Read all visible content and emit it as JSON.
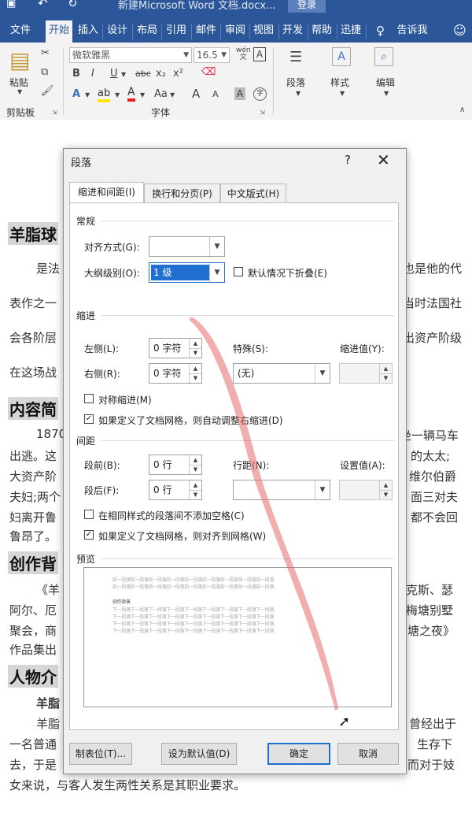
{
  "titlebar": {
    "quick_icons": [
      "save-icon",
      "undo-icon",
      "redo-icon"
    ],
    "doc_title": "新建Microsoft Word 文档.docx...",
    "login_label": "登录"
  },
  "ribbon_tabs": [
    "文件",
    "开始",
    "插入",
    "设计",
    "布局",
    "引用",
    "邮件",
    "审阅",
    "视图",
    "开发",
    "帮助",
    "迅捷",
    "告诉我"
  ],
  "ribbon": {
    "clipboard": {
      "paste_label": "粘贴",
      "group_label": "剪贴板"
    },
    "font": {
      "font_name": "微软雅黑",
      "font_size": "16.5",
      "wen_label": "wén",
      "group_label": "字体",
      "format_glyphs": [
        "B",
        "I",
        "U",
        "abc",
        "x₂",
        "x²"
      ],
      "row3_glyphs": [
        "A",
        "A",
        "Aa",
        "A",
        "A"
      ]
    },
    "paragraph_label": "段落",
    "styles_label": "样式",
    "editing_label": "编辑"
  },
  "document": {
    "lines_left": [
      "羊脂球",
      "是法",
      "表作之一",
      "会各阶层",
      "在这场战",
      "内容简",
      "1870",
      "出逃。这",
      "大资产阶",
      "夫妇;两个",
      "妇离开鲁",
      "鲁昂了。",
      "创作背",
      "《羊",
      "阿尔、厄",
      "聚会，商",
      "作品集出",
      "人物介",
      "羊脂",
      "羊脂",
      "一名普通",
      "去，于是",
      "女来说，与客人发生两性关系是其职业要求。"
    ],
    "lines_right": [
      "也是他的代",
      "当时法国社",
      "出资产阶级",
      "坐一辆马车",
      "的太太;",
      "维尔伯爵",
      "面三对夫",
      "都不会回",
      "克斯、瑟",
      "梅塘别墅",
      "塘之夜》",
      "曾经出于",
      "生存下",
      "而对于妓"
    ]
  },
  "dialog": {
    "title": "段落",
    "help_glyph": "?",
    "close_glyph": "✕",
    "tabs": [
      "缩进和间距(I)",
      "换行和分页(P)",
      "中文版式(H)"
    ],
    "general": {
      "section": "常规",
      "align_label": "对齐方式(G):",
      "align_value": "",
      "outline_label": "大纲级别(O):",
      "outline_value": "1 级",
      "collapse_label": "默认情况下折叠(E)"
    },
    "indent": {
      "section": "缩进",
      "left_label": "左侧(L):",
      "left_value": "0 字符",
      "right_label": "右侧(R):",
      "right_value": "0 字符",
      "special_label": "特殊(S):",
      "special_value": "(无)",
      "indent_value_label": "缩进值(Y):",
      "indent_value": "",
      "mirror_label": "对称缩进(M)",
      "mirror_checked": false,
      "auto_adjust_label": "如果定义了文档网格，则自动调整右缩进(D)",
      "auto_adjust_checked": true
    },
    "spacing": {
      "section": "间距",
      "before_label": "段前(B):",
      "before_value": "0 行",
      "after_label": "段后(F):",
      "after_value": "0 行",
      "line_label": "行距(N):",
      "line_value": "",
      "at_label": "设置值(A):",
      "at_value": "",
      "no_space_label": "在相同样式的段落间不添加空格(C)",
      "no_space_checked": false,
      "snap_label": "如果定义了文档网格，则对齐到网格(W)",
      "snap_checked": true
    },
    "preview": {
      "section": "预览",
      "sample_heading": "创作背景",
      "prev_para": "前一段落前一段落前一段落前一段落前一段落前一段落前一段落前一段落前一段落",
      "next_para": "下一段落下一段落下一段落下一段落下一段落下一段落下一段落下一段落下一段落"
    },
    "buttons": {
      "tabs": "制表位(T)...",
      "set_default": "设为默认值(D)",
      "ok": "确定",
      "cancel": "取消"
    }
  }
}
